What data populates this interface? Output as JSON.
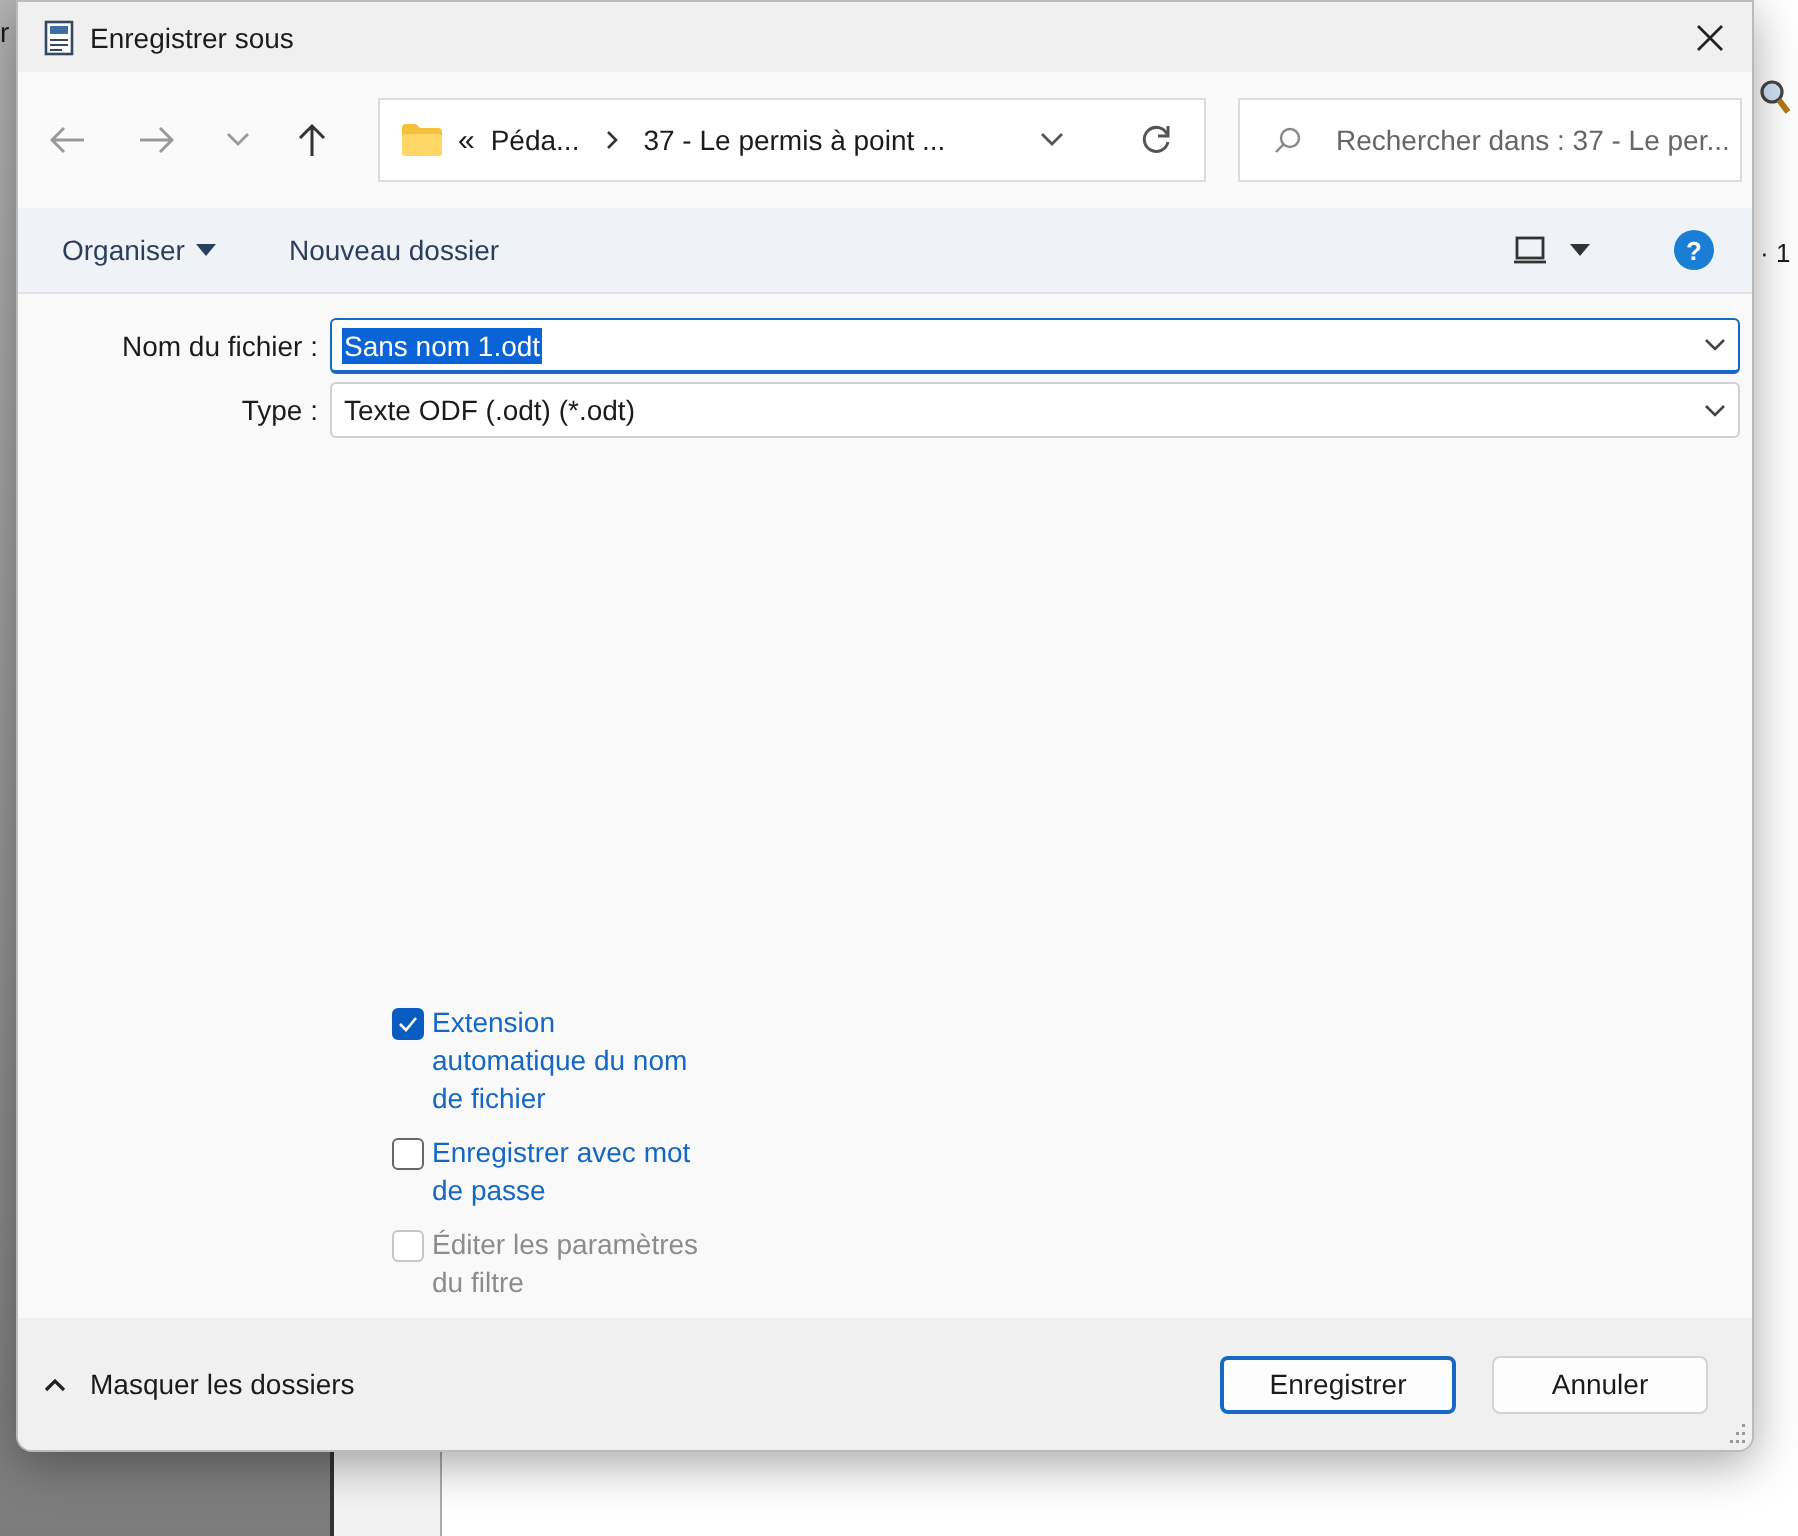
{
  "background_app": {
    "fragment_left": "r",
    "fragment_right": "· 1"
  },
  "window": {
    "title": "Enregistrer sous"
  },
  "address_bar": {
    "overflow": "«",
    "segments": [
      "Péda...",
      "37 - Le permis à point ..."
    ]
  },
  "search": {
    "placeholder": "Rechercher dans : 37 - Le per..."
  },
  "toolbar": {
    "help": "?",
    "buttons": [
      {
        "label": "Organiser",
        "kind": "menu"
      },
      {
        "label": "Nouveau dossier",
        "kind": "plain"
      }
    ]
  },
  "form": [
    {
      "label": "Nom du fichier :",
      "value": "Sans nom 1.odt",
      "focused": true
    },
    {
      "label": "Type :",
      "value": "Texte ODF (.odt) (*.odt)",
      "focused": false
    }
  ],
  "options": [
    {
      "label": "Extension automatique du nom de fichier",
      "checked": true,
      "disabled": false
    },
    {
      "label": "Enregistrer avec mot de passe",
      "checked": false,
      "disabled": false
    },
    {
      "label": "Éditer les paramètres du filtre",
      "checked": false,
      "disabled": true
    }
  ],
  "footer": {
    "toggle": "Masquer les dossiers",
    "buttons": [
      {
        "label": "Enregistrer",
        "default": true
      },
      {
        "label": "Annuler",
        "default": false
      }
    ]
  }
}
